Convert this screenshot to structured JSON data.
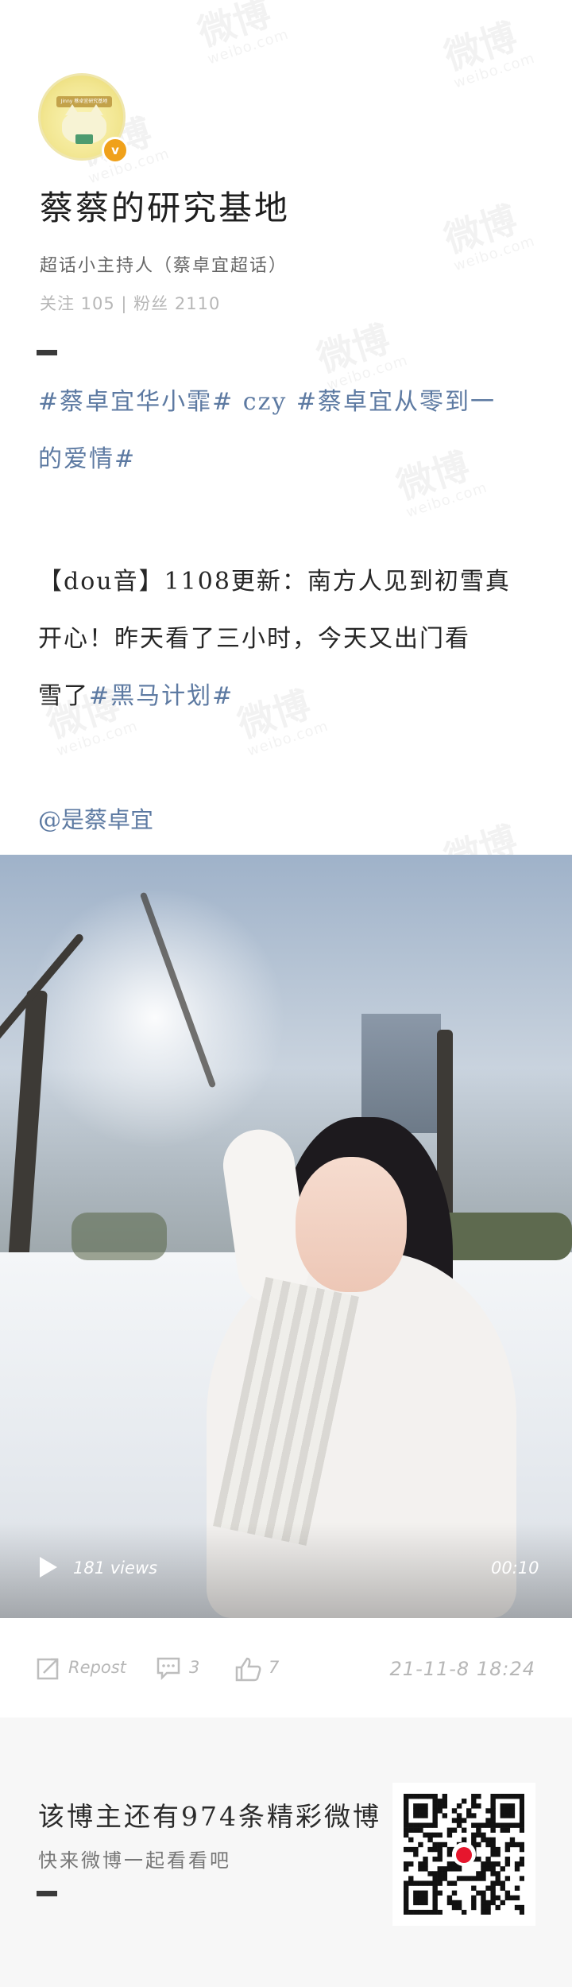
{
  "watermark": {
    "text": "微博",
    "domain": "weibo.com"
  },
  "profile": {
    "avatar_icon": "cat-avatar-icon",
    "avatar_badge": "Jinny 蔡卓宜研究基地",
    "verified_icon": "verified-badge-icon",
    "name": "蔡蔡的研究基地",
    "description": "超话小主持人（蔡卓宜超话）",
    "stats": "关注 105 | 粉丝 2110"
  },
  "post": {
    "tags_line1": "#蔡卓宜华小霏# czy #蔡卓宜从零到一",
    "tags_line2": "的爱情#",
    "body_line1": "【dou音】1108更新：南方人见到初雪真",
    "body_line2": "开心！昨天看了三小时，今天又出门看",
    "body_line3_prefix": "雪了",
    "body_line3_tag": "#黑马计划#",
    "mention": "@是蔡卓宜"
  },
  "video": {
    "play_icon": "play-icon",
    "views": "181 views",
    "duration": "00:10"
  },
  "actions": {
    "repost_label": "Repost",
    "comment_count": "3",
    "like_count": "7",
    "timestamp": "21-11-8 18:24"
  },
  "footer": {
    "title": "该博主还有974条精彩微博",
    "subtitle": "快来微博一起看看吧",
    "qr_icon": "weibo-qr-code-icon"
  },
  "colors": {
    "link": "#5d7aa2",
    "muted": "#b7b7b7",
    "verified": "#f0a11a"
  }
}
